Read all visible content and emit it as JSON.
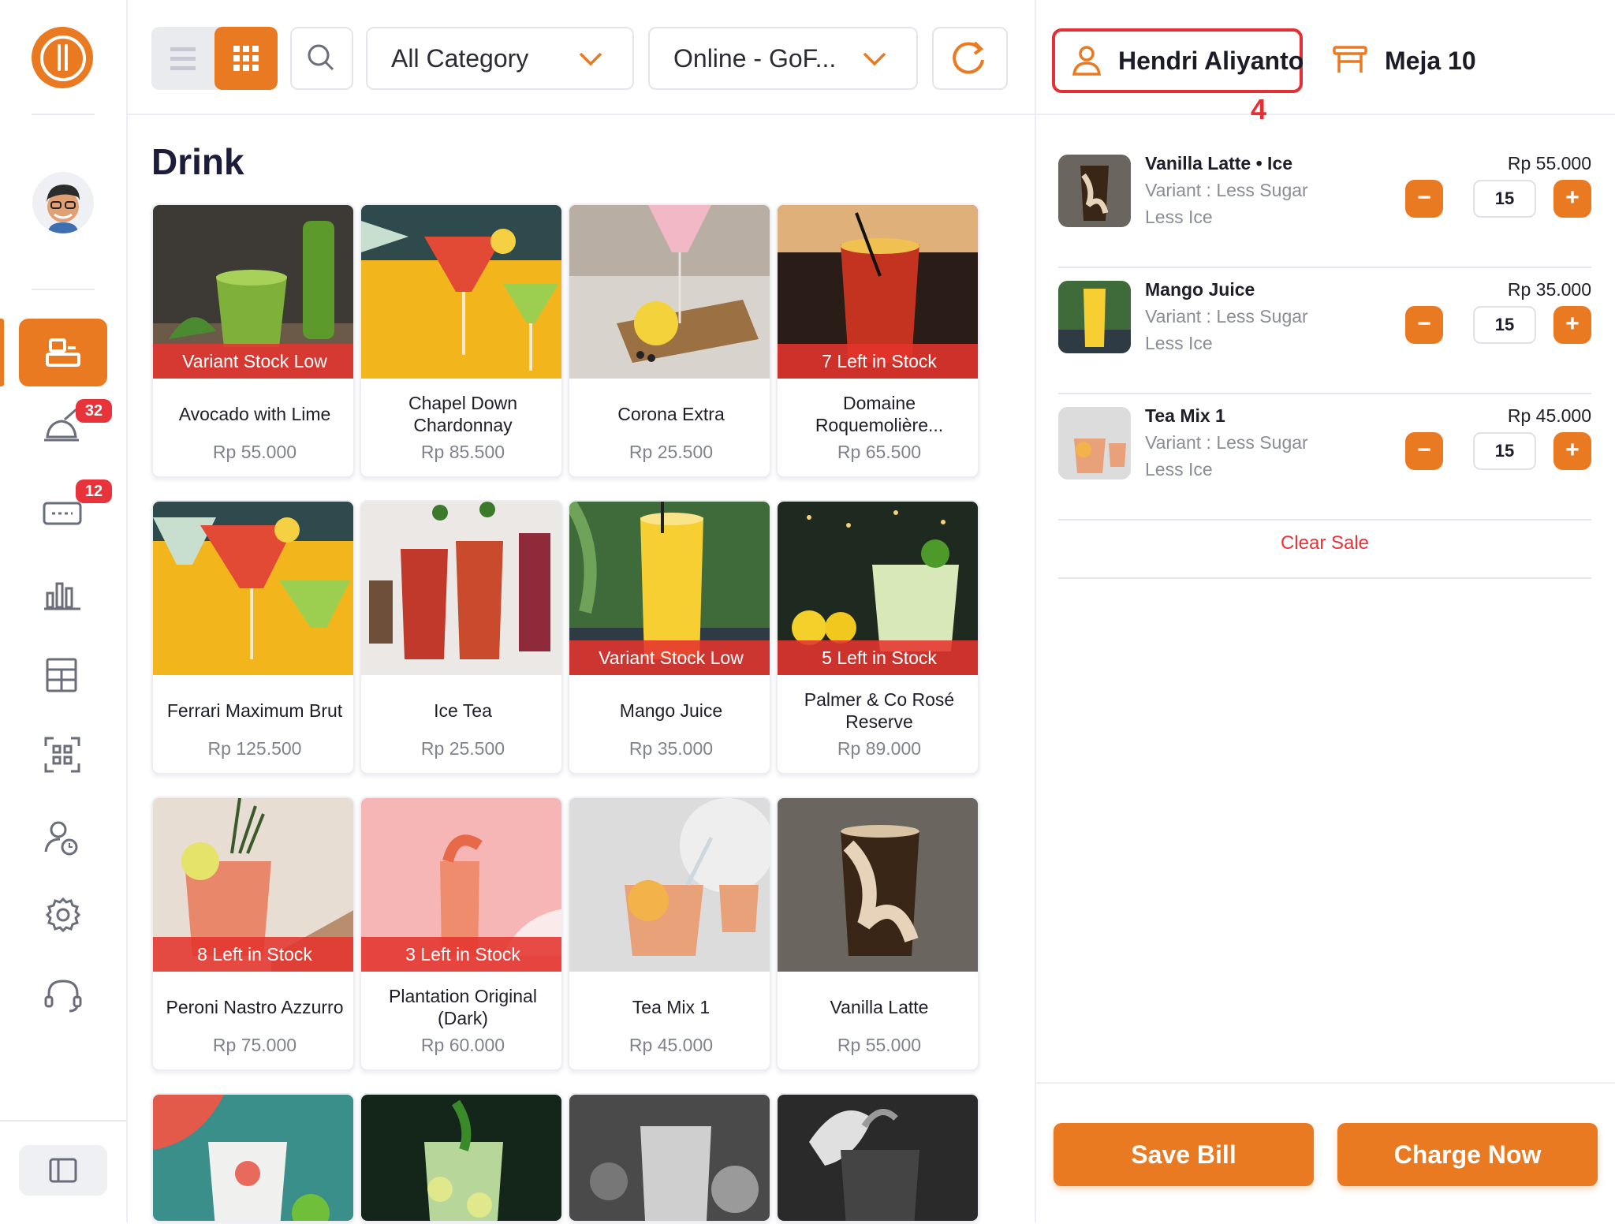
{
  "toolbar": {
    "category_value": "All Category",
    "channel_value": "Online - GoF..."
  },
  "section_title": "Drink",
  "products": [
    {
      "name": "Avocado with Lime",
      "price": "Rp 55.000",
      "stock": "Variant Stock Low"
    },
    {
      "name": "Chapel Down Chardonnay",
      "price": "Rp 85.500",
      "stock": ""
    },
    {
      "name": "Corona Extra",
      "price": "Rp 25.500",
      "stock": ""
    },
    {
      "name": "Domaine Roquemolière...",
      "price": "Rp 65.500",
      "stock": "7 Left in Stock"
    },
    {
      "name": "Ferrari Maximum Brut",
      "price": "Rp 125.500",
      "stock": ""
    },
    {
      "name": "Ice Tea",
      "price": "Rp 25.500",
      "stock": ""
    },
    {
      "name": "Mango Juice",
      "price": "Rp 35.000",
      "stock": "Variant Stock Low"
    },
    {
      "name": "Palmer & Co Rosé Reserve",
      "price": "Rp 89.000",
      "stock": "5 Left in Stock"
    },
    {
      "name": "Peroni Nastro Azzurro",
      "price": "Rp 75.000",
      "stock": "8 Left in Stock"
    },
    {
      "name": "Plantation Original (Dark)",
      "price": "Rp 60.000",
      "stock": "3 Left in Stock"
    },
    {
      "name": "Tea Mix 1",
      "price": "Rp 45.000",
      "stock": ""
    },
    {
      "name": "Vanilla Latte",
      "price": "Rp 55.000",
      "stock": ""
    }
  ],
  "sidebar": {
    "badges": {
      "orders": "32",
      "reservations": "12"
    }
  },
  "cart": {
    "customer": "Hendri Aliyanto",
    "annotation": "4",
    "table": "Meja 10",
    "items": [
      {
        "name": "Vanilla Latte • Ice",
        "variant": "Variant : Less Sugar",
        "note": "Less Ice",
        "price": "Rp 55.000",
        "qty": "15",
        "minus": "−",
        "plus": "+"
      },
      {
        "name": "Mango Juice",
        "variant": "Variant : Less Sugar",
        "note": "Less Ice",
        "price": "Rp 35.000",
        "qty": "15",
        "minus": "−",
        "plus": "+"
      },
      {
        "name": "Tea Mix 1",
        "variant": "Variant : Less Sugar",
        "note": "Less Ice",
        "price": "Rp 45.000",
        "qty": "15",
        "minus": "−",
        "plus": "+"
      }
    ],
    "clear_sale": "Clear Sale",
    "save_bill": "Save Bill",
    "charge_now": "Charge Now"
  },
  "colors": {
    "accent": "#ea7a22",
    "danger": "#e8333a",
    "annotation": "#e33035"
  }
}
